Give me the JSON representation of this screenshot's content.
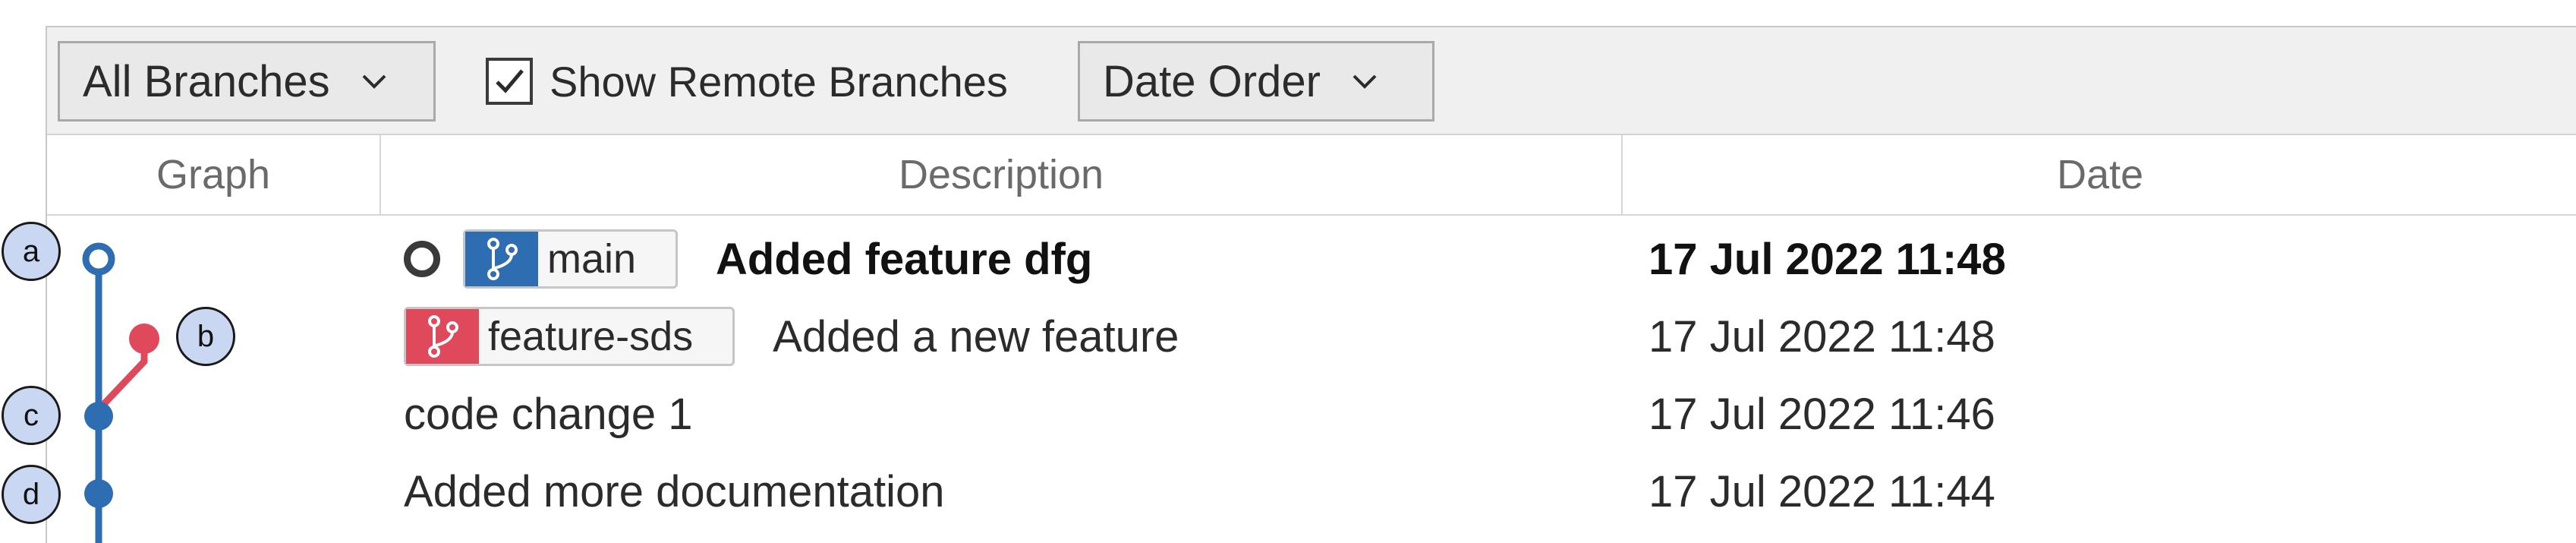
{
  "toolbar": {
    "branches_dropdown": "All Branches",
    "show_remote_label": "Show Remote Branches",
    "show_remote_checked": true,
    "order_dropdown": "Date Order"
  },
  "columns": {
    "graph": "Graph",
    "description": "Description",
    "date": "Date"
  },
  "commits": [
    {
      "branch_tag": "main",
      "message": "Added feature dfg",
      "date": "17 Jul 2022 11:48",
      "is_head": true
    },
    {
      "branch_tag": "feature-sds",
      "message": "Added a new feature",
      "date": "17 Jul 2022 11:48"
    },
    {
      "message": "code change 1",
      "date": "17 Jul 2022 11:46"
    },
    {
      "message": "Added more documentation",
      "date": "17 Jul 2022 11:44"
    }
  ],
  "callouts": [
    "a",
    "b",
    "c",
    "d"
  ],
  "colors": {
    "main_branch": "#2f6db3",
    "feature_branch": "#e0485c",
    "callout_fill": "#c9d7f2"
  },
  "icons": {
    "dropdown": "chevron-down-icon",
    "checkbox": "checkmark-icon",
    "branch": "git-branch-icon"
  }
}
